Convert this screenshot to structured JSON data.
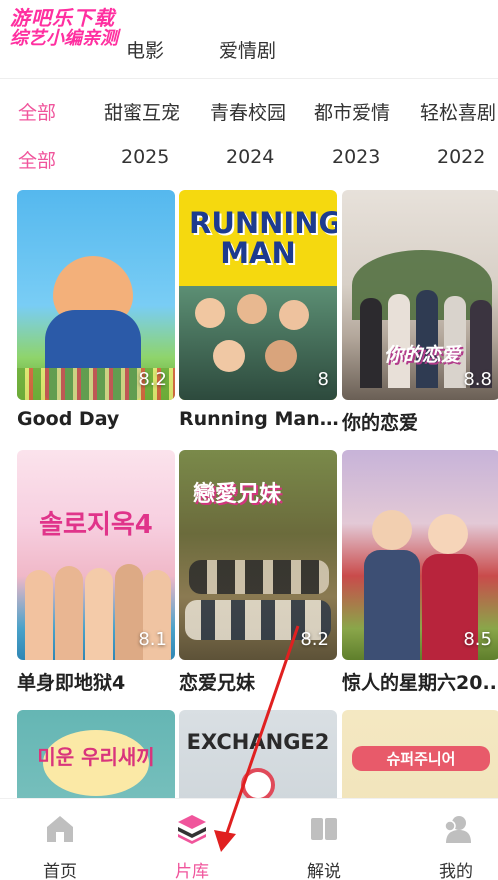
{
  "watermark": {
    "line1": "游吧乐下载",
    "line2": "综艺小编亲测"
  },
  "top_categories": [
    "电影",
    "爱情剧"
  ],
  "genre_filters": [
    "全部",
    "甜蜜互宠",
    "青春校园",
    "都市爱情",
    "轻松喜剧"
  ],
  "year_filters": [
    "全部",
    "2025",
    "2024",
    "2023",
    "2022"
  ],
  "shows": [
    {
      "title": "Good Day",
      "rating": "8.2",
      "poster_text": ""
    },
    {
      "title": "Running Man20...",
      "rating": "8",
      "poster_text": "RUNNING MAN"
    },
    {
      "title": "你的恋爱",
      "rating": "8.8",
      "poster_text": "你的恋爱"
    },
    {
      "title": "单身即地狱4",
      "rating": "8.1",
      "poster_text": "솔로지옥4"
    },
    {
      "title": "恋爱兄妹",
      "rating": "8.2",
      "poster_text": "戀愛兄妹"
    },
    {
      "title": "惊人的星期六20...",
      "rating": "8.5",
      "poster_text": ""
    },
    {
      "title": "",
      "rating": "",
      "poster_text": "미운 우리새끼"
    },
    {
      "title": "",
      "rating": "",
      "poster_text": "EXCHANGE2"
    },
    {
      "title": "",
      "rating": "",
      "poster_text": "슈퍼주니어"
    }
  ],
  "bottom_nav": [
    {
      "label": "首页",
      "icon": "home-icon",
      "active": false
    },
    {
      "label": "片库",
      "icon": "library-stack-icon",
      "active": true
    },
    {
      "label": "解说",
      "icon": "book-icon",
      "active": false
    },
    {
      "label": "我的",
      "icon": "user-icon",
      "active": false
    }
  ],
  "colors": {
    "accent": "#f0559c",
    "annotation_arrow": "#e02020"
  }
}
